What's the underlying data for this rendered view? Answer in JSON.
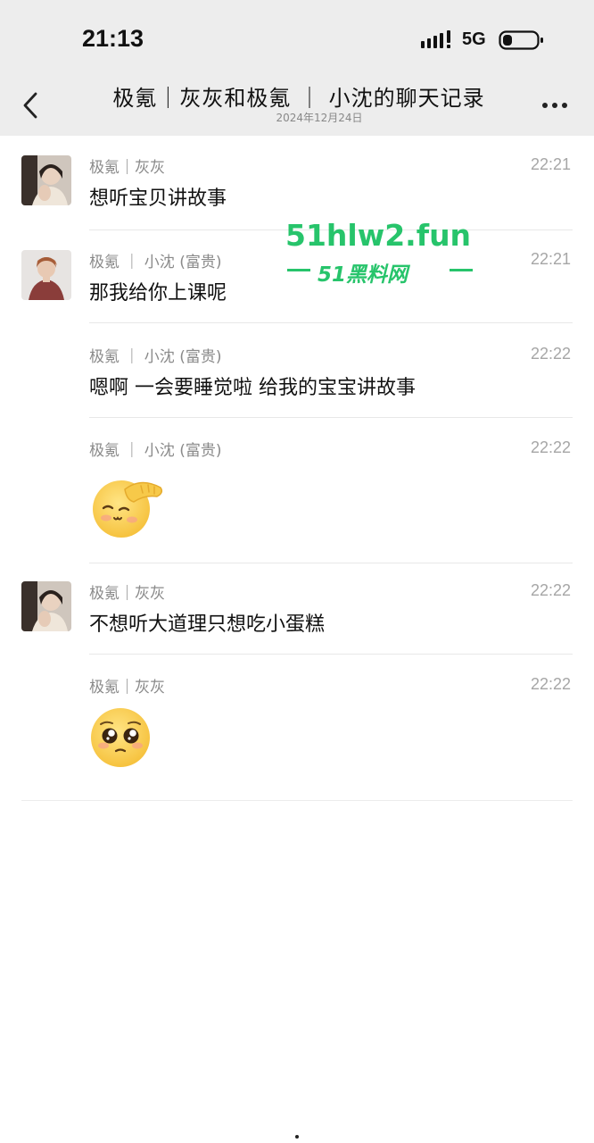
{
  "status_bar": {
    "time": "21:13",
    "network": "5G"
  },
  "nav": {
    "title": "极氪｜灰灰和极氪 ｜ 小沈的聊天记录",
    "subtitle": "2024年12月24日"
  },
  "messages": [
    {
      "sender": "极氪｜灰灰",
      "time": "22:21",
      "text": "想听宝贝讲故事"
    },
    {
      "sender": "极氪 ｜ 小沈 (富贵)",
      "time": "22:21",
      "text": "那我给你上课呢"
    },
    {
      "sender": "极氪 ｜ 小沈 (富贵)",
      "time": "22:22",
      "text": "嗯啊 一会要睡觉啦 给我的宝宝讲故事"
    },
    {
      "sender": "极氪 ｜ 小沈 (富贵)",
      "time": "22:22",
      "sticker": "salute-emoji-icon"
    },
    {
      "sender": "极氪｜灰灰",
      "time": "22:22",
      "text": "不想听大道理只想吃小蛋糕"
    },
    {
      "sender": "极氪｜灰灰",
      "time": "22:22",
      "sticker": "pleading-emoji-icon"
    }
  ],
  "watermark": {
    "domain": "51hlw2.fun",
    "name": "51黑料网"
  },
  "colors": {
    "header_bg": "#ededed",
    "watermark_green": "#27c46b",
    "sticker_yellow": "#ffd75a"
  }
}
